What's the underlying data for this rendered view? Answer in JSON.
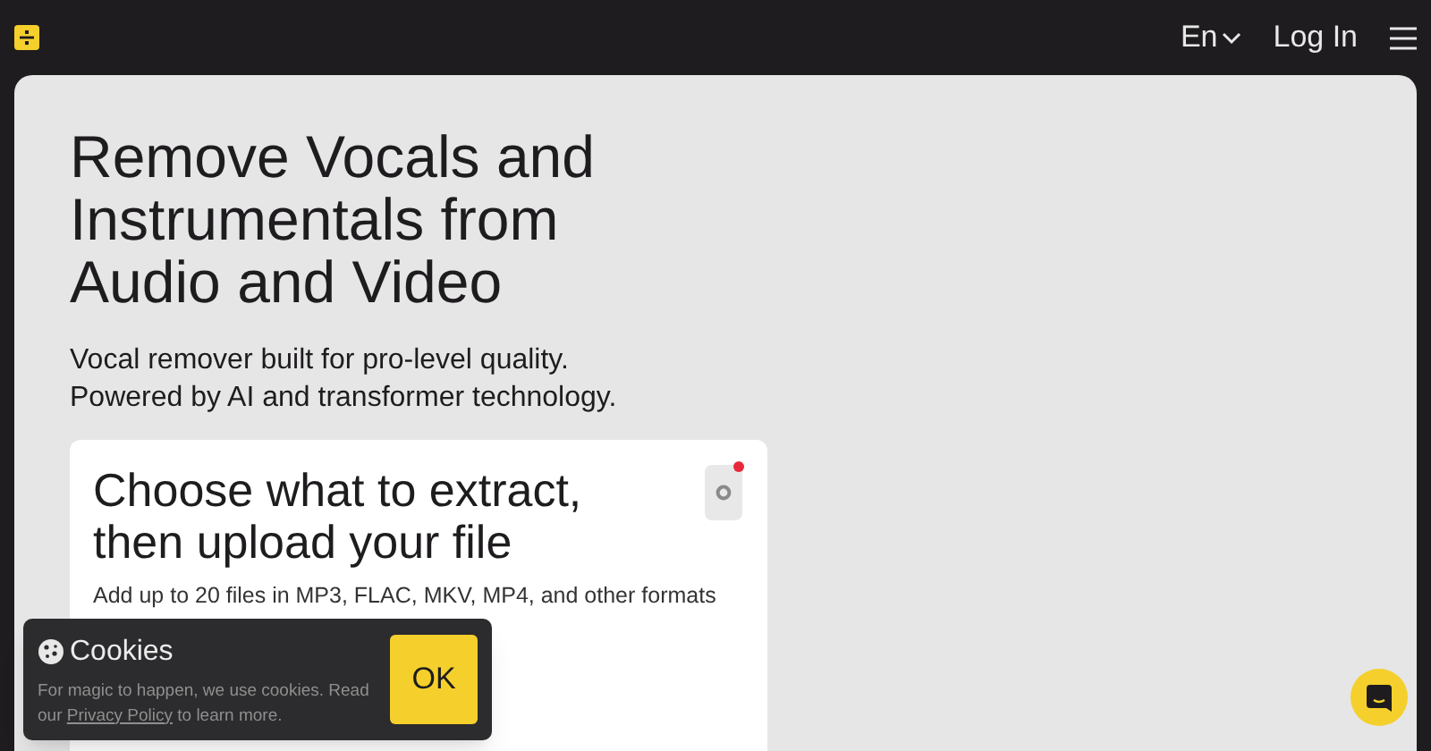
{
  "header": {
    "language": "En",
    "login": "Log In"
  },
  "hero": {
    "title": "Remove Vocals and Instrumentals from Audio and Video",
    "subtitle_lines": [
      "Vocal remover built for pro-level quality.",
      "Powered by AI and transformer technology."
    ]
  },
  "upload_card": {
    "title_lines": [
      "Choose what to extract,",
      "then upload your file"
    ],
    "hint": "Add up to 20 files in MP3, FLAC, MKV, MP4, and other formats",
    "settings_alert": true
  },
  "cookie_banner": {
    "title": "Cookies",
    "text_before": "For magic to happen, we use cookies. Read our ",
    "link": "Privacy Policy",
    "text_after": " to learn more.",
    "button": "OK"
  }
}
